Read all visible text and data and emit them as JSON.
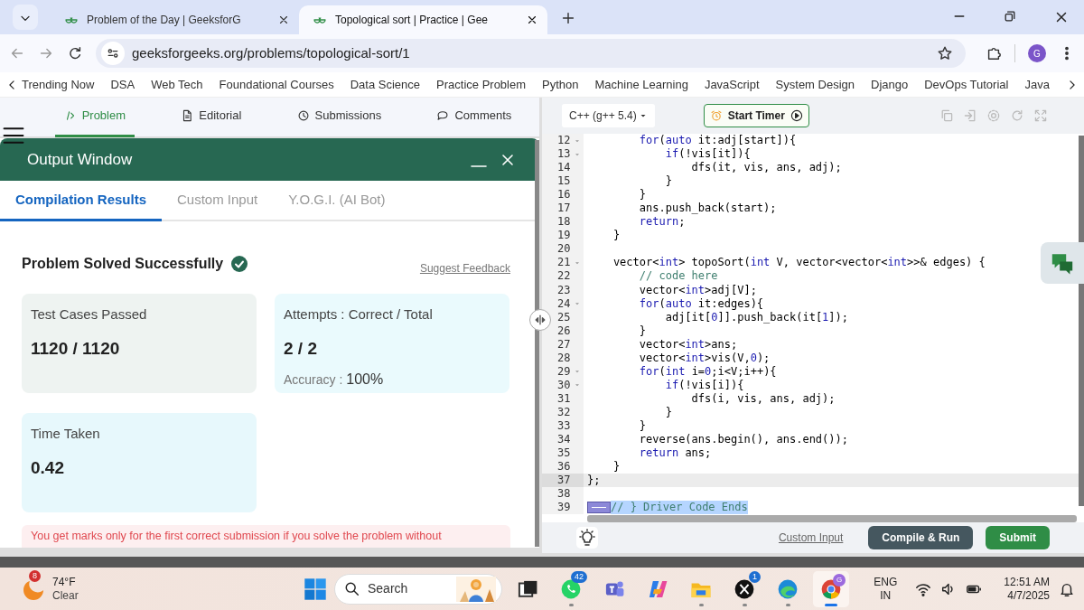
{
  "browser": {
    "tabs": [
      {
        "title": "Problem of the Day | GeeksforG",
        "selected": false
      },
      {
        "title": "Topological sort | Practice | Gee",
        "selected": true
      }
    ],
    "url": "geeksforgeeks.org/problems/topological-sort/1",
    "profile_initial": "G"
  },
  "site_nav": [
    "Trending Now",
    "DSA",
    "Web Tech",
    "Foundational Courses",
    "Data Science",
    "Practice Problem",
    "Python",
    "Machine Learning",
    "JavaScript",
    "System Design",
    "Django",
    "DevOps Tutorial",
    "Java"
  ],
  "problem_tabs": [
    {
      "label": "Problem",
      "kind": "code",
      "selected": true
    },
    {
      "label": "Editorial",
      "kind": "document",
      "selected": false
    },
    {
      "label": "Submissions",
      "kind": "clock",
      "selected": false
    },
    {
      "label": "Comments",
      "kind": "chat",
      "selected": false
    }
  ],
  "output_window": {
    "title": "Output Window",
    "tabs": [
      {
        "label": "Compilation Results",
        "selected": true
      },
      {
        "label": "Custom Input",
        "selected": false
      },
      {
        "label": "Y.O.G.I. (AI Bot)",
        "selected": false
      }
    ],
    "status": "Problem Solved Successfully",
    "feedback_link": "Suggest Feedback",
    "stats": [
      {
        "label": "Test Cases Passed",
        "value": "1120 / 1120"
      },
      {
        "label": "Attempts : Correct / Total",
        "value": "2 / 2",
        "accuracy_label": "Accuracy :",
        "accuracy": "100%"
      },
      {
        "label": "Time Taken",
        "value": "0.42"
      }
    ],
    "notice": "You get marks only for the first correct submission if you solve the problem without"
  },
  "editor": {
    "language": "C++ (g++ 5.4)",
    "timer_button": "Start Timer",
    "lines": [
      {
        "n": "12",
        "fold": true,
        "code": [
          {
            "kind": "keyword",
            "text": "        for"
          },
          {
            "kind": "plain",
            "text": "("
          },
          {
            "kind": "keyword",
            "text": "auto"
          },
          {
            "kind": "plain",
            "text": " it:adj[start]){"
          }
        ]
      },
      {
        "n": "13",
        "fold": true,
        "code": [
          {
            "kind": "keyword",
            "text": "            if"
          },
          {
            "kind": "plain",
            "text": "(!vis[it]){"
          }
        ]
      },
      {
        "n": "14",
        "code": [
          {
            "kind": "plain",
            "text": "                dfs(it, vis, ans, adj);"
          }
        ]
      },
      {
        "n": "15",
        "code": [
          {
            "kind": "plain",
            "text": "            }"
          }
        ]
      },
      {
        "n": "16",
        "code": [
          {
            "kind": "plain",
            "text": "        }"
          }
        ]
      },
      {
        "n": "17",
        "code": [
          {
            "kind": "plain",
            "text": "        ans.push_back(start);"
          }
        ]
      },
      {
        "n": "18",
        "code": [
          {
            "kind": "keyword",
            "text": "        return"
          },
          {
            "kind": "plain",
            "text": ";"
          }
        ]
      },
      {
        "n": "19",
        "code": [
          {
            "kind": "plain",
            "text": "    }"
          }
        ]
      },
      {
        "n": "20"
      },
      {
        "n": "21",
        "fold": true,
        "code": [
          {
            "kind": "plain",
            "text": "    vector<"
          },
          {
            "kind": "keyword",
            "text": "int"
          },
          {
            "kind": "plain",
            "text": "> topoSort("
          },
          {
            "kind": "keyword",
            "text": "int"
          },
          {
            "kind": "plain",
            "text": " V, vector<vector<"
          },
          {
            "kind": "keyword",
            "text": "int"
          },
          {
            "kind": "plain",
            "text": ">>& edges) {"
          }
        ]
      },
      {
        "n": "22",
        "code": [
          {
            "kind": "comment",
            "text": "        // code here"
          }
        ]
      },
      {
        "n": "23",
        "code": [
          {
            "kind": "plain",
            "text": "        vector<"
          },
          {
            "kind": "keyword",
            "text": "int"
          },
          {
            "kind": "plain",
            "text": ">adj[V];"
          }
        ]
      },
      {
        "n": "24",
        "fold": true,
        "code": [
          {
            "kind": "keyword",
            "text": "        for"
          },
          {
            "kind": "plain",
            "text": "("
          },
          {
            "kind": "keyword",
            "text": "auto"
          },
          {
            "kind": "plain",
            "text": " it:edges){"
          }
        ]
      },
      {
        "n": "25",
        "code": [
          {
            "kind": "plain",
            "text": "            adj[it["
          },
          {
            "kind": "keyword",
            "text": "0"
          },
          {
            "kind": "plain",
            "text": "]].push_back(it["
          },
          {
            "kind": "keyword",
            "text": "1"
          },
          {
            "kind": "plain",
            "text": "]);"
          }
        ]
      },
      {
        "n": "26",
        "code": [
          {
            "kind": "plain",
            "text": "        }"
          }
        ]
      },
      {
        "n": "27",
        "code": [
          {
            "kind": "plain",
            "text": "        vector<"
          },
          {
            "kind": "keyword",
            "text": "int"
          },
          {
            "kind": "plain",
            "text": ">ans;"
          }
        ]
      },
      {
        "n": "28",
        "code": [
          {
            "kind": "plain",
            "text": "        vector<"
          },
          {
            "kind": "keyword",
            "text": "int"
          },
          {
            "kind": "plain",
            "text": ">vis(V,"
          },
          {
            "kind": "keyword",
            "text": "0"
          },
          {
            "kind": "plain",
            "text": ");"
          }
        ]
      },
      {
        "n": "29",
        "fold": true,
        "code": [
          {
            "kind": "keyword",
            "text": "        for"
          },
          {
            "kind": "plain",
            "text": "("
          },
          {
            "kind": "keyword",
            "text": "int"
          },
          {
            "kind": "plain",
            "text": " i="
          },
          {
            "kind": "keyword",
            "text": "0"
          },
          {
            "kind": "plain",
            "text": ";i<V;i++){"
          }
        ]
      },
      {
        "n": "30",
        "fold": true,
        "code": [
          {
            "kind": "keyword",
            "text": "            if"
          },
          {
            "kind": "plain",
            "text": "(!vis[i]){"
          }
        ]
      },
      {
        "n": "31",
        "code": [
          {
            "kind": "plain",
            "text": "                dfs(i, vis, ans, adj);"
          }
        ]
      },
      {
        "n": "32",
        "code": [
          {
            "kind": "plain",
            "text": "            }"
          }
        ]
      },
      {
        "n": "33",
        "code": [
          {
            "kind": "plain",
            "text": "        }"
          }
        ]
      },
      {
        "n": "34",
        "code": [
          {
            "kind": "plain",
            "text": "        reverse(ans.begin(), ans.end());"
          }
        ]
      },
      {
        "n": "35",
        "code": [
          {
            "kind": "keyword",
            "text": "        return"
          },
          {
            "kind": "plain",
            "text": " ans;"
          }
        ]
      },
      {
        "n": "36",
        "code": [
          {
            "kind": "plain",
            "text": "    }"
          }
        ]
      },
      {
        "n": "37",
        "current": true,
        "code": [
          {
            "kind": "plain",
            "text": "};"
          }
        ]
      },
      {
        "n": "38"
      },
      {
        "n": "39",
        "selected": true,
        "code": [
          {
            "kind": "comment",
            "text": "// } Driver Code Ends"
          }
        ]
      }
    ],
    "custom_input": "Custom Input",
    "buttons": [
      {
        "label": "Compile & Run",
        "kind": "run"
      },
      {
        "label": "Submit",
        "kind": "submit"
      }
    ]
  },
  "taskbar": {
    "weather": {
      "badge": "8",
      "temperature": "74°F",
      "condition": "Clear"
    },
    "search_placeholder": "Search",
    "apps": [
      {
        "kind": "taskview",
        "running": false,
        "active": false
      },
      {
        "kind": "whatsapp",
        "badge": "42",
        "running": true,
        "active": false
      },
      {
        "kind": "teams",
        "running": false,
        "active": false
      },
      {
        "kind": "copilot",
        "running": false,
        "active": false
      },
      {
        "kind": "explorer",
        "running": true,
        "active": false
      },
      {
        "kind": "x",
        "badge": "1",
        "running": true,
        "active": false
      },
      {
        "kind": "edge",
        "running": true,
        "active": false
      },
      {
        "kind": "chrome",
        "profile_badge": "G",
        "running": true,
        "active": true
      }
    ],
    "language": "ENG",
    "region": "IN",
    "time": "12:51 AM",
    "date": "4/7/2025"
  }
}
